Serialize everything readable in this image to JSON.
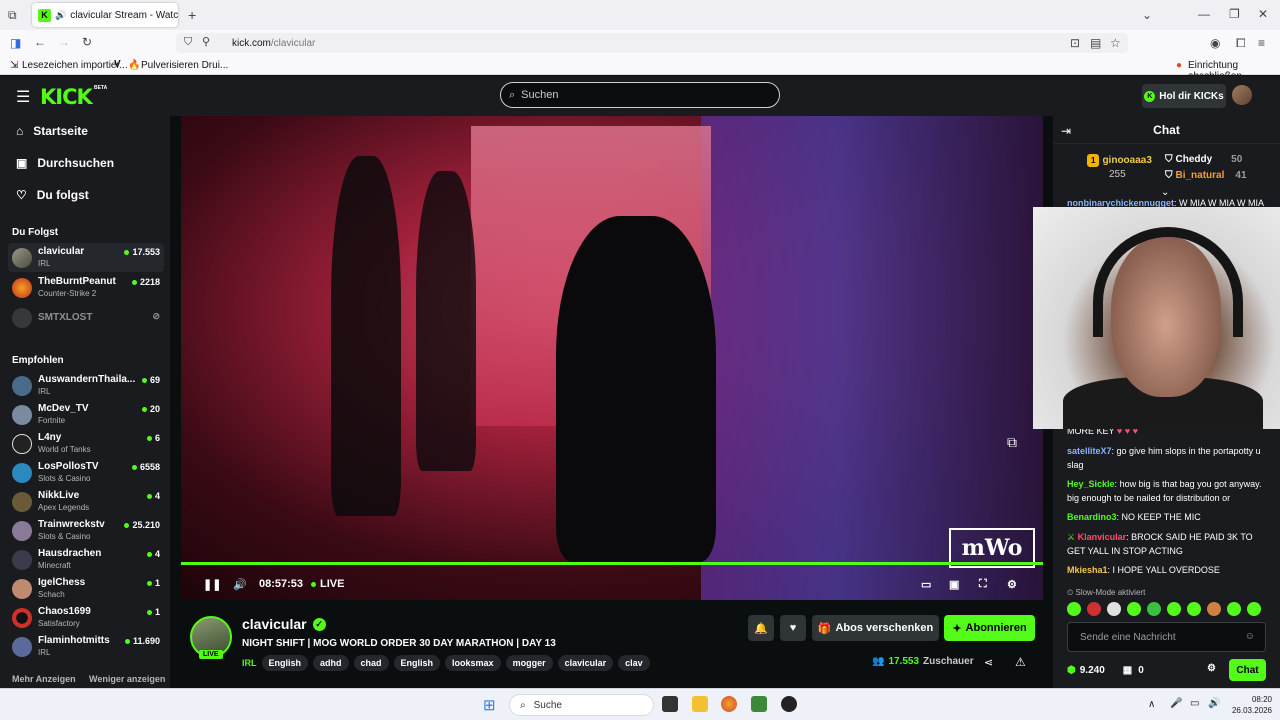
{
  "browser": {
    "tab_title": "clavicular Stream - Watch L",
    "url_host": "kick.com",
    "url_path": "/clavicular",
    "bookmarks": [
      "Lesezeichen importier...",
      "Pulverisieren Drui..."
    ],
    "setup_label": "Einrichtung abschließen"
  },
  "site": {
    "logo": "KICK",
    "beta": "BETA",
    "search_placeholder": "Suchen",
    "get_kicks": "Hol dir KICKs"
  },
  "sidebar": {
    "nav": [
      {
        "label": "Startseite",
        "icon": "home-icon"
      },
      {
        "label": "Durchsuchen",
        "icon": "browse-icon"
      },
      {
        "label": "Du folgst",
        "icon": "heart-icon"
      }
    ],
    "following_title": "Du Folgst",
    "following": [
      {
        "name": "clavicular",
        "category": "IRL",
        "viewers": "17.553",
        "live": true
      },
      {
        "name": "TheBurntPeanut",
        "category": "Counter-Strike 2",
        "viewers": "2218",
        "live": true
      },
      {
        "name": "SMTXLOST",
        "category": "",
        "viewers": "",
        "live": false
      }
    ],
    "recommended_title": "Empfohlen",
    "recommended": [
      {
        "name": "AuswandernThaila...",
        "category": "IRL",
        "viewers": "69"
      },
      {
        "name": "McDev_TV",
        "category": "Fortnite",
        "viewers": "20"
      },
      {
        "name": "L4ny",
        "category": "World of Tanks",
        "viewers": "6"
      },
      {
        "name": "LosPollosTV",
        "category": "Slots & Casino",
        "viewers": "6558"
      },
      {
        "name": "NikkLive",
        "category": "Apex Legends",
        "viewers": "4"
      },
      {
        "name": "Trainwreckstv",
        "category": "Slots & Casino",
        "viewers": "25.210"
      },
      {
        "name": "Hausdrachen",
        "category": "Minecraft",
        "viewers": "4"
      },
      {
        "name": "IgelChess",
        "category": "Schach",
        "viewers": "1"
      },
      {
        "name": "Chaos1699",
        "category": "Satisfactory",
        "viewers": "1"
      },
      {
        "name": "Flaminhotmitts",
        "category": "IRL",
        "viewers": "11.690"
      }
    ],
    "show_more": "Mehr Anzeigen",
    "show_less": "Weniger anzeigen"
  },
  "player": {
    "time": "08:57:53",
    "live_label": "LIVE",
    "watermark": "mWo",
    "progress": 1.0
  },
  "stream": {
    "channel": "clavicular",
    "live_badge": "LIVE",
    "title": "NIGHT SHIFT | MOG WORLD ORDER 30 DAY MARATHON | DAY 13",
    "category": "IRL",
    "tags": [
      "English",
      "adhd",
      "chad",
      "English",
      "looksmax",
      "mogger",
      "clavicular",
      "clav"
    ],
    "gift_subs": "Abos verschenken",
    "subscribe": "Abonnieren",
    "viewers": "17.553",
    "viewers_label": "Zuschauer"
  },
  "chat": {
    "title": "Chat",
    "leaders": [
      {
        "rank": "1",
        "name": "ginooaaa3",
        "count": "255"
      },
      {
        "name": "Cheddy",
        "count": "50"
      },
      {
        "name": "Bi_natural",
        "count": "41"
      }
    ],
    "messages": [
      {
        "user": "nonbinarychickennugget",
        "color": "#8ab4f8",
        "text": "W MIA W MIA W MIA"
      },
      {
        "user": "",
        "color": "#ffffff",
        "text": "MORE KEY"
      },
      {
        "user": "satelliteX7",
        "color": "#8ab4f8",
        "text": "go give him slops in the portapotty u slag"
      },
      {
        "user": "Hey_Sickle",
        "color": "#53fc18",
        "text": "how big is that bag you got anyway. big enough to be nailed for distribution or"
      },
      {
        "user": "Benardino3",
        "color": "#53fc18",
        "text": "NO KEEP THE MIC"
      },
      {
        "user": "Klanvicular",
        "color": "#ff4d6d",
        "text": "BROCK SAID HE PAID 3K TO GET YALL IN STOP ACTING"
      },
      {
        "user": "Mkiesha1",
        "color": "#f2c94c",
        "text": "I HOPE YALL OVERDOSE"
      }
    ],
    "slow_mode": "Slow-Mode aktiviert",
    "input_placeholder": "Sende eine Nachricht",
    "points": "9.240",
    "gifts": "0",
    "send": "Chat"
  },
  "taskbar": {
    "search": "Suche",
    "time": "08:20",
    "date": "26.03.2026"
  },
  "colors": {
    "accent": "#53fc18",
    "bg": "#0b0e0f",
    "panel": "#191b1f"
  }
}
